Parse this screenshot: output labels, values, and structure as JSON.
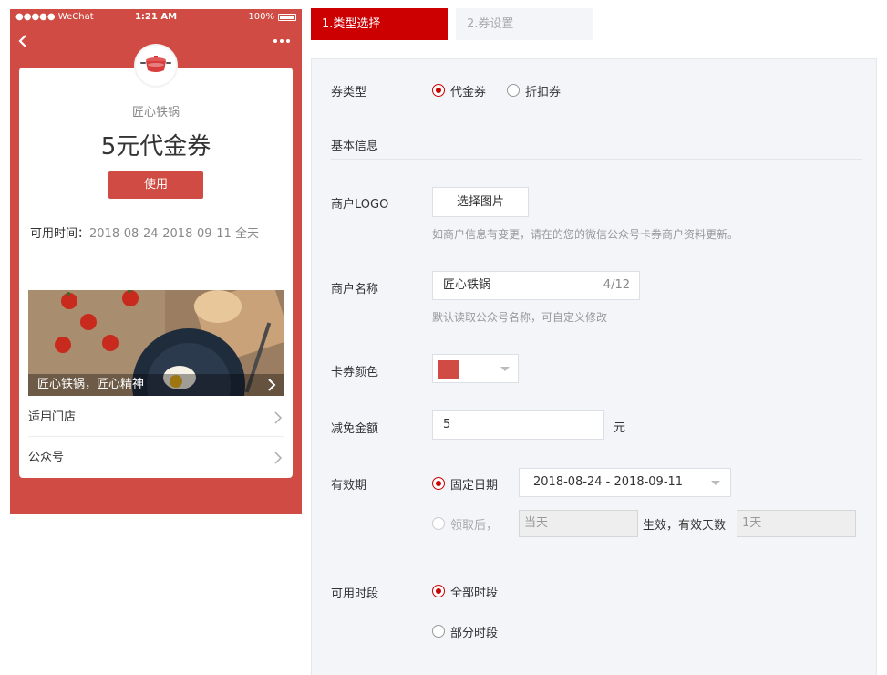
{
  "status_bar": {
    "carrier": "●●●●● WeChat",
    "time": "1:21 AM",
    "battery": "100%"
  },
  "preview": {
    "merchant_name": "匠心铁锅",
    "coupon_title": "5元代金券",
    "use_button": "使用",
    "validity_label": "可用时间：",
    "validity_value": "2018-08-24-2018-09-11 全天",
    "banner_caption": "匠心铁锅，匠心精神",
    "rows": [
      {
        "label": "适用门店"
      },
      {
        "label": "公众号"
      }
    ]
  },
  "steps": [
    {
      "label": "1.类型选择",
      "active": true
    },
    {
      "label": "2.券设置",
      "active": false
    }
  ],
  "form": {
    "coupon_type": {
      "label": "券类型",
      "options": [
        {
          "label": "代金券",
          "selected": true
        },
        {
          "label": "折扣券",
          "selected": false
        }
      ]
    },
    "basic_info_title": "基本信息",
    "logo": {
      "label": "商户LOGO",
      "button": "选择图片",
      "hint": "如商户信息有变更，请在的您的微信公众号卡券商户资料更新。"
    },
    "merchant_name": {
      "label": "商户名称",
      "value": "匠心铁锅",
      "counter": "4/12",
      "hint": "默认读取公众号名称，可自定义修改"
    },
    "card_color": {
      "label": "卡券颜色",
      "value": "#cf4b43"
    },
    "discount_amount": {
      "label": "减免金额",
      "value": "5",
      "unit": "元"
    },
    "validity": {
      "label": "有效期",
      "fixed": {
        "label": "固定日期",
        "selected": true,
        "range": "2018-08-24 - 2018-09-11"
      },
      "relative": {
        "label": "领取后，",
        "selected": false,
        "start": "当天",
        "middle": "生效，有效天数",
        "days": "1天"
      }
    },
    "time_slot": {
      "label": "可用时段",
      "options": [
        {
          "label": "全部时段",
          "selected": true
        },
        {
          "label": "部分时段",
          "selected": false
        }
      ]
    }
  },
  "colors": {
    "brand_red": "#cf4b43",
    "step_active": "#cc0000",
    "panel_bg": "#f4f5f9"
  }
}
